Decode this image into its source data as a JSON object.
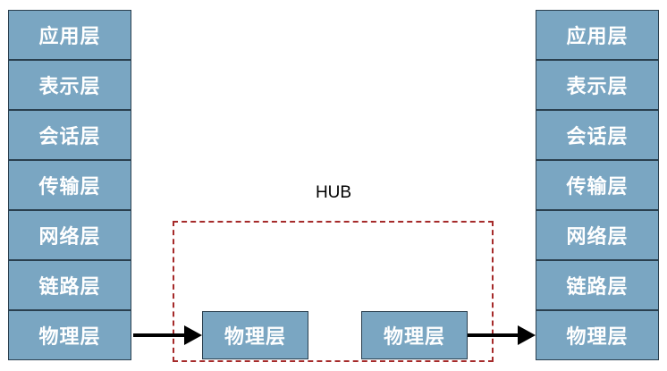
{
  "left_stack": {
    "layers": [
      "应用层",
      "表示层",
      "会话层",
      "传输层",
      "网络层",
      "链路层",
      "物理层"
    ]
  },
  "right_stack": {
    "layers": [
      "应用层",
      "表示层",
      "会话层",
      "传输层",
      "网络层",
      "链路层",
      "物理层"
    ]
  },
  "hub": {
    "label": "HUB",
    "ports": [
      "物理层",
      "物理层"
    ],
    "border_color": "#a52a2a"
  },
  "colors": {
    "layer_fill": "#7aa6c2",
    "layer_border": "#2a3f4e",
    "layer_text": "#ffffff",
    "arrow": "#000000"
  }
}
